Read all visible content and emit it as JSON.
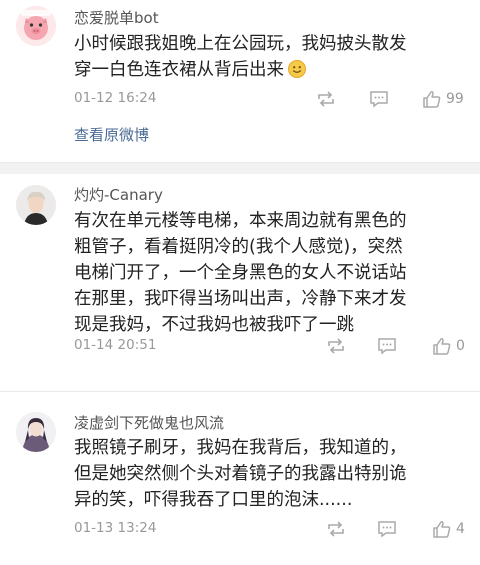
{
  "comments": [
    {
      "username": "恋爱脱单bot",
      "content": "小时候跟我姐晚上在公园玩，我妈披头散发\n穿一白色连衣裙从背后出来",
      "emoji": "smile-emoji",
      "time": "01-12 16:24",
      "likes": "99",
      "view_original": "查看原微博"
    },
    {
      "username": "灼灼-Canary",
      "content": "有次在单元楼等电梯，本来周边就有黑色的\n粗管子，看着挺阴冷的(我个人感觉)，突然\n电梯门开了，一个全身黑色的女人不说话站\n在那里，我吓得当场叫出声，冷静下来才发\n现是我妈，不过我妈也被我吓了一跳",
      "time": "01-14 20:51",
      "likes": "0"
    },
    {
      "username": "凌虚剑下死做鬼也风流",
      "content": "我照镜子刷牙，我妈在我背后，我知道的，\n但是她突然侧个头对着镜子的我露出特别诡\n异的笑，吓得我吞了口里的泡沫......",
      "time": "01-13 13:24",
      "likes": "4"
    }
  ],
  "icons": {
    "repost": "repost-icon",
    "comment": "comment-icon",
    "like": "thumbs-up-icon"
  },
  "colors": {
    "link": "#4a6b97",
    "meta": "#999999",
    "avatar1_bg": "#f7c9cf"
  }
}
